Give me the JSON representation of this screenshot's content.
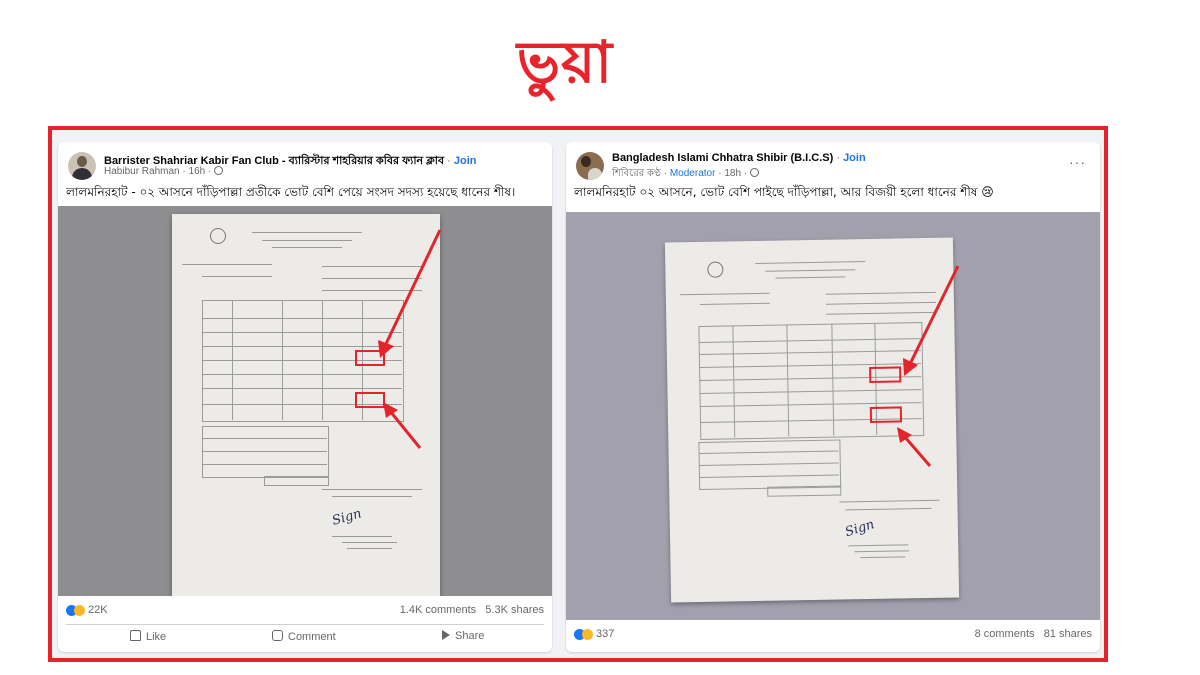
{
  "stamp": "ভুয়া",
  "colors": {
    "accent_red": "#e3242b",
    "link_blue": "#1b74e4",
    "muted": "#65676b"
  },
  "posts": [
    {
      "group": "Barrister Shahriar Kabir Fan Club - ব্যারিস্টার শাহরিয়ার কবির ফ্যান ক্লাব",
      "join": "Join",
      "author": "Habibur Rahman",
      "time": "16h",
      "caption": "লালমনিরহাট - ০২ আসনে দাঁড়িপাল্লা প্রতীকে ভোট বেশি পেয়ে সংসদ সদস্য হয়েছে ধানের শীষ।",
      "reactions": "22K",
      "comments": "1.4K comments",
      "shares": "5.3K shares",
      "actions": {
        "like": "Like",
        "comment": "Comment",
        "share": "Share"
      }
    },
    {
      "group": "Bangladesh Islami Chhatra Shibir (B.I.C.S)",
      "join": "Join",
      "author": "শিবিরের কণ্ঠ",
      "role": "Moderator",
      "time": "18h",
      "caption": "লালমনিরহাট ০২ আসনে, ভোট বেশি পাইছে দাঁড়িপাল্লা, আর বিজয়ী হলো ধানের শীষ 😢",
      "reactions": "337",
      "comments": "8 comments",
      "shares": "81 shares",
      "more": "···"
    }
  ]
}
